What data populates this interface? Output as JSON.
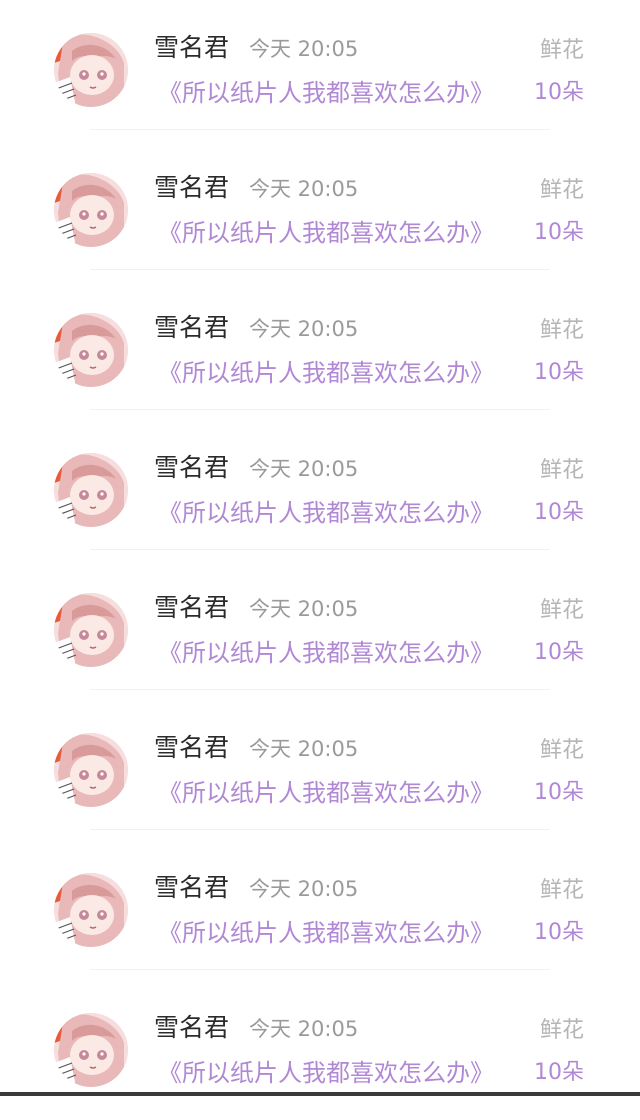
{
  "colors": {
    "accent": "#b088d6",
    "name_text": "#2b2b2b",
    "secondary_text": "#9a9a9a",
    "muted_text": "#b5b5b5"
  },
  "avatar_icon": "anime-girl-avatar",
  "items": [
    {
      "username": "雪名君",
      "time": "今天 20:05",
      "book_title": "《所以纸片人我都喜欢怎么办》",
      "gift_type": "鲜花",
      "gift_count": "10朵"
    },
    {
      "username": "雪名君",
      "time": "今天 20:05",
      "book_title": "《所以纸片人我都喜欢怎么办》",
      "gift_type": "鲜花",
      "gift_count": "10朵"
    },
    {
      "username": "雪名君",
      "time": "今天 20:05",
      "book_title": "《所以纸片人我都喜欢怎么办》",
      "gift_type": "鲜花",
      "gift_count": "10朵"
    },
    {
      "username": "雪名君",
      "time": "今天 20:05",
      "book_title": "《所以纸片人我都喜欢怎么办》",
      "gift_type": "鲜花",
      "gift_count": "10朵"
    },
    {
      "username": "雪名君",
      "time": "今天 20:05",
      "book_title": "《所以纸片人我都喜欢怎么办》",
      "gift_type": "鲜花",
      "gift_count": "10朵"
    },
    {
      "username": "雪名君",
      "time": "今天 20:05",
      "book_title": "《所以纸片人我都喜欢怎么办》",
      "gift_type": "鲜花",
      "gift_count": "10朵"
    },
    {
      "username": "雪名君",
      "time": "今天 20:05",
      "book_title": "《所以纸片人我都喜欢怎么办》",
      "gift_type": "鲜花",
      "gift_count": "10朵"
    },
    {
      "username": "雪名君",
      "time": "今天 20:05",
      "book_title": "《所以纸片人我都喜欢怎么办》",
      "gift_type": "鲜花",
      "gift_count": "10朵"
    }
  ]
}
